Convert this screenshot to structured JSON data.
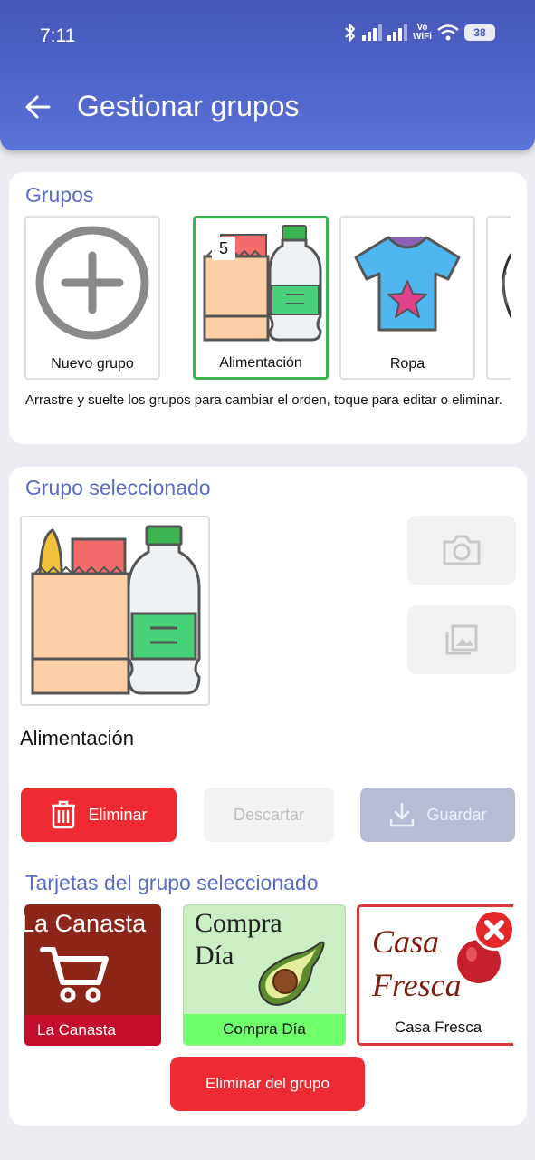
{
  "status": {
    "time": "7:11",
    "battery": "38",
    "vowifi_top": "Vo",
    "vowifi_bottom": "WiFi"
  },
  "header": {
    "title": "Gestionar grupos"
  },
  "groups": {
    "title": "Grupos",
    "items": [
      {
        "label": "Nuevo grupo",
        "icon": "plus-circle-icon"
      },
      {
        "label": "Alimentación",
        "icon": "groceries-icon",
        "badge": "5",
        "selected": true
      },
      {
        "label": "Ropa",
        "icon": "tshirt-icon"
      }
    ],
    "hint": "Arrastre y suelte los grupos para cambiar el orden, toque para editar o eliminar."
  },
  "selected": {
    "title": "Grupo seleccionado",
    "name": "Alimentación",
    "buttons": {
      "delete": "Eliminar",
      "discard": "Descartar",
      "save": "Guardar"
    }
  },
  "cards": {
    "title": "Tarjetas del grupo seleccionado",
    "items": [
      {
        "logo_text": "La Canasta",
        "label": "La Canasta"
      },
      {
        "logo_line1": "Compra",
        "logo_line2": "Día",
        "label": "Compra Día"
      },
      {
        "logo_line1": "Casa",
        "logo_line2": "Fresca",
        "label": "Casa Fresca"
      }
    ],
    "remove_button": "Eliminar del grupo"
  },
  "colors": {
    "accent": "#5b6cc2",
    "danger": "#ee2b33",
    "selected_border": "#3cb451"
  }
}
